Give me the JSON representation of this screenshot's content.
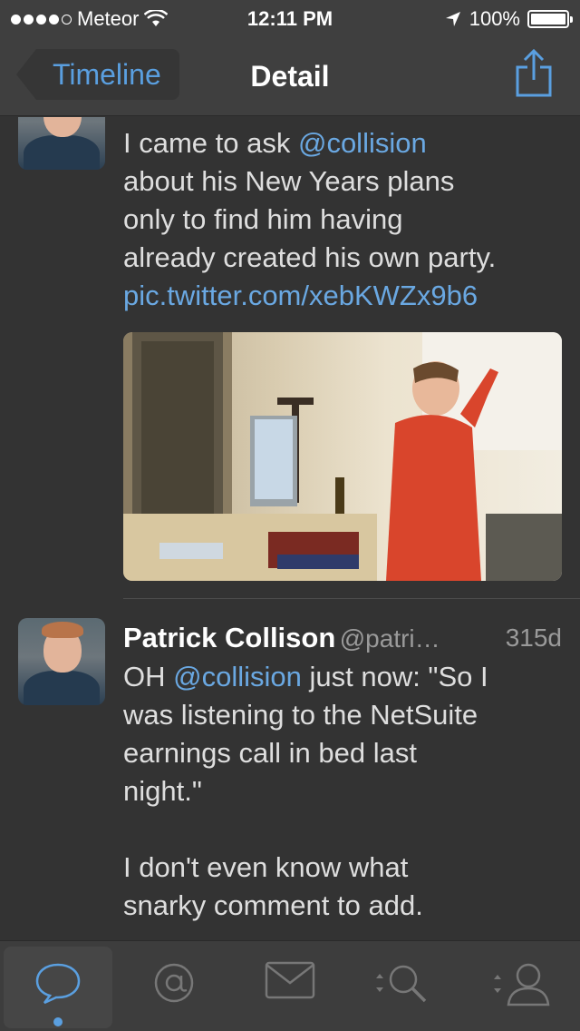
{
  "status_bar": {
    "carrier": "Meteor",
    "time": "12:11 PM",
    "battery": "100%",
    "battery_level": 1.0,
    "signal_dots_filled": 4,
    "signal_dots_total": 5
  },
  "nav": {
    "back_label": "Timeline",
    "title": "Detail"
  },
  "tweets": [
    {
      "text_lines": [
        {
          "parts": [
            {
              "t": "I came to ask "
            },
            {
              "t": "@collision",
              "mention": true
            }
          ]
        },
        {
          "parts": [
            {
              "t": "about his New Years plans"
            }
          ]
        },
        {
          "parts": [
            {
              "t": "only to find him having"
            }
          ]
        },
        {
          "parts": [
            {
              "t": "already created his own party."
            }
          ]
        },
        {
          "parts": [
            {
              "t": "pic.twitter.com/xebKWZx9b6",
              "link": true
            }
          ]
        }
      ],
      "has_photo": true
    },
    {
      "name": "Patrick Collison",
      "handle": "@patri…",
      "time_ago": "315d",
      "text_lines": [
        {
          "parts": [
            {
              "t": "OH "
            },
            {
              "t": "@collision",
              "mention": true
            },
            {
              "t": " just now: \"So I"
            }
          ]
        },
        {
          "parts": [
            {
              "t": "was listening to the NetSuite"
            }
          ]
        },
        {
          "parts": [
            {
              "t": "earnings call in bed last"
            }
          ]
        },
        {
          "parts": [
            {
              "t": "night.\""
            }
          ]
        },
        {
          "parts": [
            {
              "t": ""
            }
          ]
        },
        {
          "parts": [
            {
              "t": "I don't even know what"
            }
          ]
        },
        {
          "parts": [
            {
              "t": "snarky comment to add."
            }
          ]
        }
      ]
    }
  ],
  "tabs": [
    {
      "icon": "speech-bubble-icon",
      "active": true
    },
    {
      "icon": "at-sign-icon",
      "active": false
    },
    {
      "icon": "envelope-icon",
      "active": false
    },
    {
      "icon": "search-icon",
      "active": false
    },
    {
      "icon": "user-icon",
      "active": false
    }
  ],
  "colors": {
    "accent": "#5a9fe0",
    "mention": "#6aa8e2",
    "background": "#333333",
    "bar": "#3f3f3f"
  }
}
